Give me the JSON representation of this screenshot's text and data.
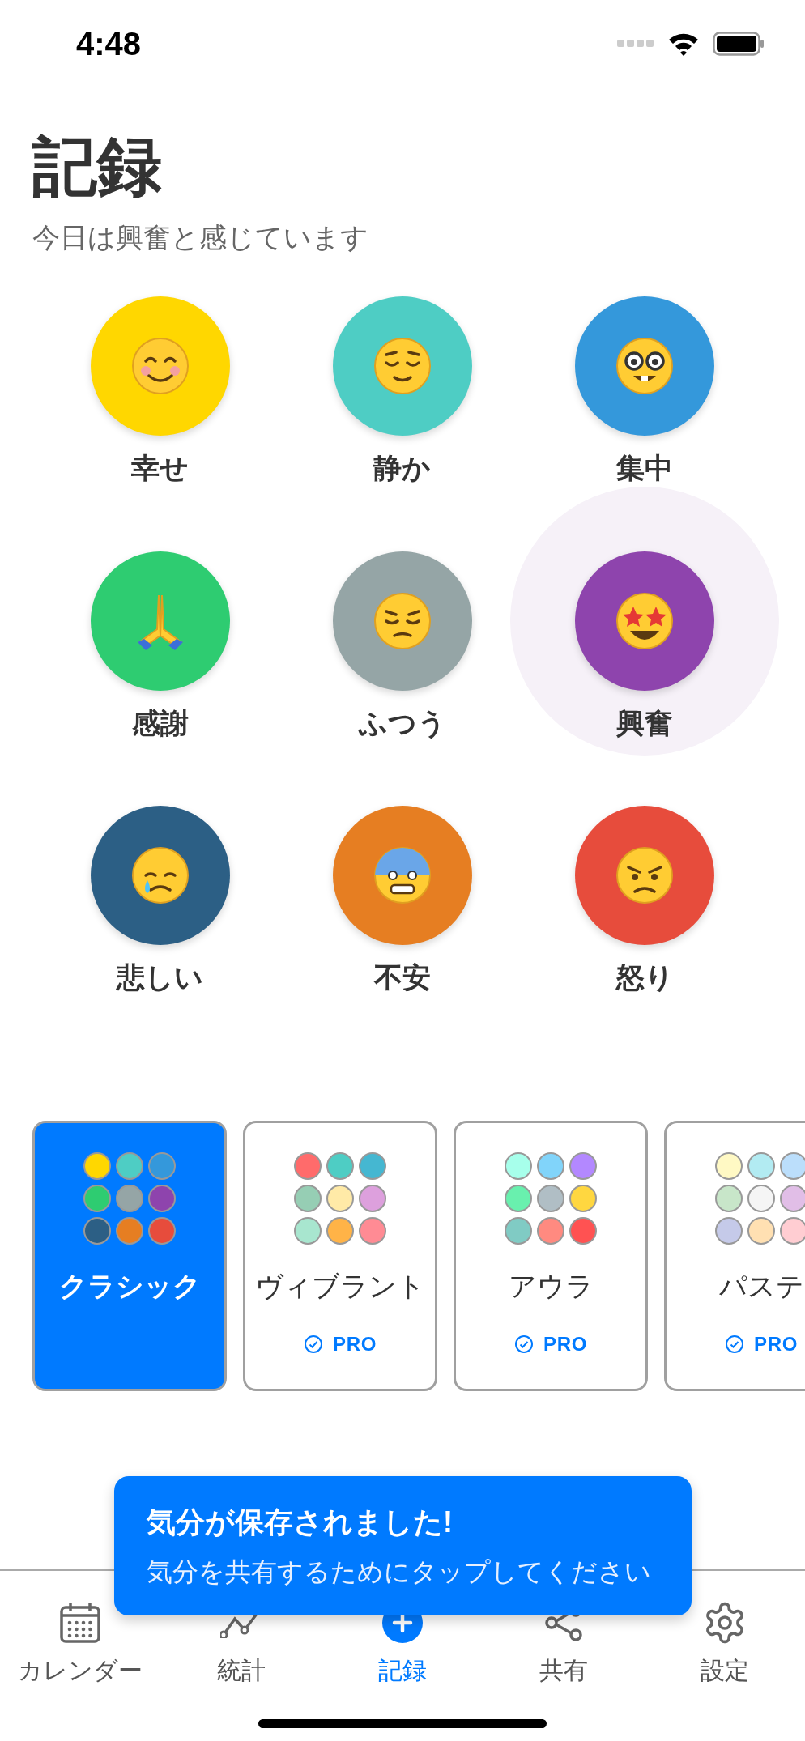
{
  "status_bar": {
    "time": "4:48"
  },
  "header": {
    "title": "記録",
    "subtitle": "今日は興奮と感じています"
  },
  "moods": [
    {
      "label": "幸せ",
      "color": "#ffd700",
      "selected": false
    },
    {
      "label": "静か",
      "color": "#4ecdc4",
      "selected": false
    },
    {
      "label": "集中",
      "color": "#3498db",
      "selected": false
    },
    {
      "label": "感謝",
      "color": "#2ecc71",
      "selected": false
    },
    {
      "label": "ふつう",
      "color": "#95a5a6",
      "selected": false
    },
    {
      "label": "興奮",
      "color": "#8e44ad",
      "selected": true
    },
    {
      "label": "悲しい",
      "color": "#2c5f85",
      "selected": false
    },
    {
      "label": "不安",
      "color": "#e67e22",
      "selected": false
    },
    {
      "label": "怒り",
      "color": "#e74c3c",
      "selected": false
    }
  ],
  "palettes": [
    {
      "name": "クラシック",
      "selected": true,
      "swatches": [
        {
          "color": "#ffd700"
        },
        {
          "color": "#4ecdc4"
        },
        {
          "color": "#3498db"
        },
        {
          "color": "#2ecc71"
        },
        {
          "color": "#95a5a6"
        },
        {
          "color": "#8e44ad"
        },
        {
          "color": "#2c5f85"
        },
        {
          "color": "#e67e22"
        },
        {
          "color": "#e74c3c"
        }
      ]
    },
    {
      "name": "ヴィブラント",
      "selected": false,
      "badge": "PRO",
      "swatches": [
        {
          "color": "#ff6b6b"
        },
        {
          "color": "#4ecdc4"
        },
        {
          "color": "#45b7d1"
        },
        {
          "color": "#96ceb4"
        },
        {
          "color": "#ffeaa7"
        },
        {
          "color": "#dda0dd"
        },
        {
          "color": "#a8e6cf"
        },
        {
          "color": "#ffb347"
        },
        {
          "color": "#ff8b94"
        }
      ]
    },
    {
      "name": "アウラ",
      "selected": false,
      "badge": "PRO",
      "swatches": [
        {
          "color": "#a7ffeb"
        },
        {
          "color": "#81d4fa"
        },
        {
          "color": "#b388ff"
        },
        {
          "color": "#69f0ae"
        },
        {
          "color": "#b0bec5"
        },
        {
          "color": "#ffd740"
        },
        {
          "color": "#80cbc4"
        },
        {
          "color": "#ff8a80"
        },
        {
          "color": "#ff5252"
        }
      ]
    },
    {
      "name": "パステ",
      "selected": false,
      "badge": "PRO",
      "swatches": [
        {
          "color": "#fff9c4"
        },
        {
          "color": "#b2ebf2"
        },
        {
          "color": "#bbdefb"
        },
        {
          "color": "#c8e6c9"
        },
        {
          "color": "#f5f5f5"
        },
        {
          "color": "#e1bee7"
        },
        {
          "color": "#c5cae9"
        },
        {
          "color": "#ffe0b2"
        },
        {
          "color": "#ffcdd2"
        }
      ]
    }
  ],
  "toast": {
    "title": "気分が保存されました!",
    "message": "気分を共有するためにタップしてください"
  },
  "tabs": [
    {
      "label": "カレンダー",
      "selected": false
    },
    {
      "label": "統計",
      "selected": false
    },
    {
      "label": "記録",
      "selected": true
    },
    {
      "label": "共有",
      "selected": false
    },
    {
      "label": "設定",
      "selected": false
    }
  ]
}
